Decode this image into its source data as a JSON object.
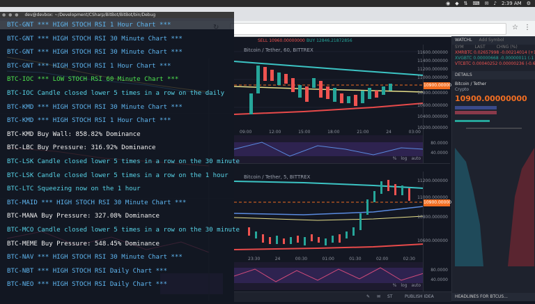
{
  "system_bar": {
    "clock": "2:39 AM"
  },
  "terminal": {
    "title": "dev@devbox: ~/Development/CSharp/BitBot/BitBot/bin/Debug",
    "lines": [
      {
        "text": "BTC-GNT *** HIGH STOCH RSI 1 Hour Chart ***",
        "color": "blue"
      },
      {
        "text": "BTC-GNT *** HIGH STOCH RSI 30 Minute Chart ***",
        "color": "blue"
      },
      {
        "text": "BTC-GNT *** HIGH STOCH RSI 30 Minute Chart ***",
        "color": "blue"
      },
      {
        "text": "BTC-GNT *** HIGH STOCH RSI 1 Hour Chart ***",
        "color": "blue"
      },
      {
        "text": "BTC-IOC *** LOW STOCH RSI 60 Minute Chart ***",
        "color": "green"
      },
      {
        "text": "BTC-IOC Candle closed lower 5 times in a row on the daily",
        "color": "cyan"
      },
      {
        "text": "BTC-KMD *** HIGH STOCH RSI 30 Minute Chart ***",
        "color": "blue"
      },
      {
        "text": "BTC-KMD *** HIGH STOCH RSI 1 Hour Chart ***",
        "color": "blue"
      },
      {
        "text": "BTC-KMD Buy Wall: 858.82% Dominance",
        "color": "white"
      },
      {
        "text": "BTC-LBC Buy Pressure: 316.92% Dominance",
        "color": "white"
      },
      {
        "text": "BTC-LSK Candle closed lower 5 times in a row on the 30 minute",
        "color": "cyan"
      },
      {
        "text": "BTC-LSK Candle closed lower 5 times in a row on the 1 hour",
        "color": "cyan"
      },
      {
        "text": "BTC-LTC Squeezing now on the 1 hour",
        "color": "cyan"
      },
      {
        "text": "BTC-MAID *** HIGH STOCH RSI 30 Minute Chart ***",
        "color": "blue"
      },
      {
        "text": "BTC-MANA Buy Pressure: 327.08% Dominance",
        "color": "white"
      },
      {
        "text": "BTC-MCO Candle closed lower 5 times in a row on the 30 minute",
        "color": "cyan"
      },
      {
        "text": "BTC-MEME Buy Pressure: 548.45% Dominance",
        "color": "white"
      },
      {
        "text": "BTC-NAV *** HIGH STOCH RSI 30 Minute Chart ***",
        "color": "blue"
      },
      {
        "text": "BTC-NBT *** HIGH STOCH RSI Daily Chart ***",
        "color": "blue"
      },
      {
        "text": "BTC-NEO *** HIGH STOCH RSI Daily Chart ***",
        "color": "blue"
      }
    ]
  },
  "chart_top": {
    "title": "Bitcoin / Tether, 60, BITTREX",
    "sell_label": "SELL",
    "buy_label": "BUY",
    "sell_value": "10960.00000000",
    "buy_value": "12846.21872856",
    "price_tag": "10900.00000000",
    "yticks": [
      "11600.000000",
      "11400.000000",
      "11200.000000",
      "11000.000000",
      "10800.000000",
      "10600.000000",
      "10400.000000",
      "10200.000000"
    ],
    "xticks": [
      "09:00",
      "12:00",
      "15:00",
      "18:00",
      "21:00",
      "24",
      "03:00"
    ],
    "lower_ticks": [
      "80.0000",
      "40.0000"
    ],
    "buttons": {
      "percent": "%",
      "log": "log",
      "auto": "auto"
    }
  },
  "chart_bottom": {
    "title": "Bitcoin / Tether, 5, BITTREX",
    "price_tag": "10900.00000000",
    "yticks": [
      "11200.000000",
      "11000.000000",
      "10800.000000",
      "10600.000000"
    ],
    "xticks": [
      "23:30",
      "24",
      "00:30",
      "01:00",
      "01:30",
      "02:00",
      "02:30"
    ],
    "lower_ticks": [
      "80.0000",
      "40.0000"
    ],
    "buttons": {
      "percent": "%",
      "log": "log",
      "auto": "auto"
    }
  },
  "right_panel": {
    "watchlist_label": "WATCHL",
    "add_symbol": "Add Symbol",
    "cols": [
      "SYM",
      "LAST",
      "CHNG (%)"
    ],
    "rows": [
      "XMRBTC 0.02657998 -0.00214014 (+1",
      "XVGBTC 0.00000668 -0.00000011 (-1",
      "VTCBTC 0.00040252 0.00000236 (-0.6"
    ],
    "details_label": "DETAILS",
    "symbol_name": "Bitcoin / Tether",
    "symbol_type": "Crypto",
    "last_price": "10900.00000000",
    "headlines": "HEADLINES FOR BTCUS..."
  },
  "bottom_bar": {
    "publish": "PUBLISH IDEA"
  }
}
